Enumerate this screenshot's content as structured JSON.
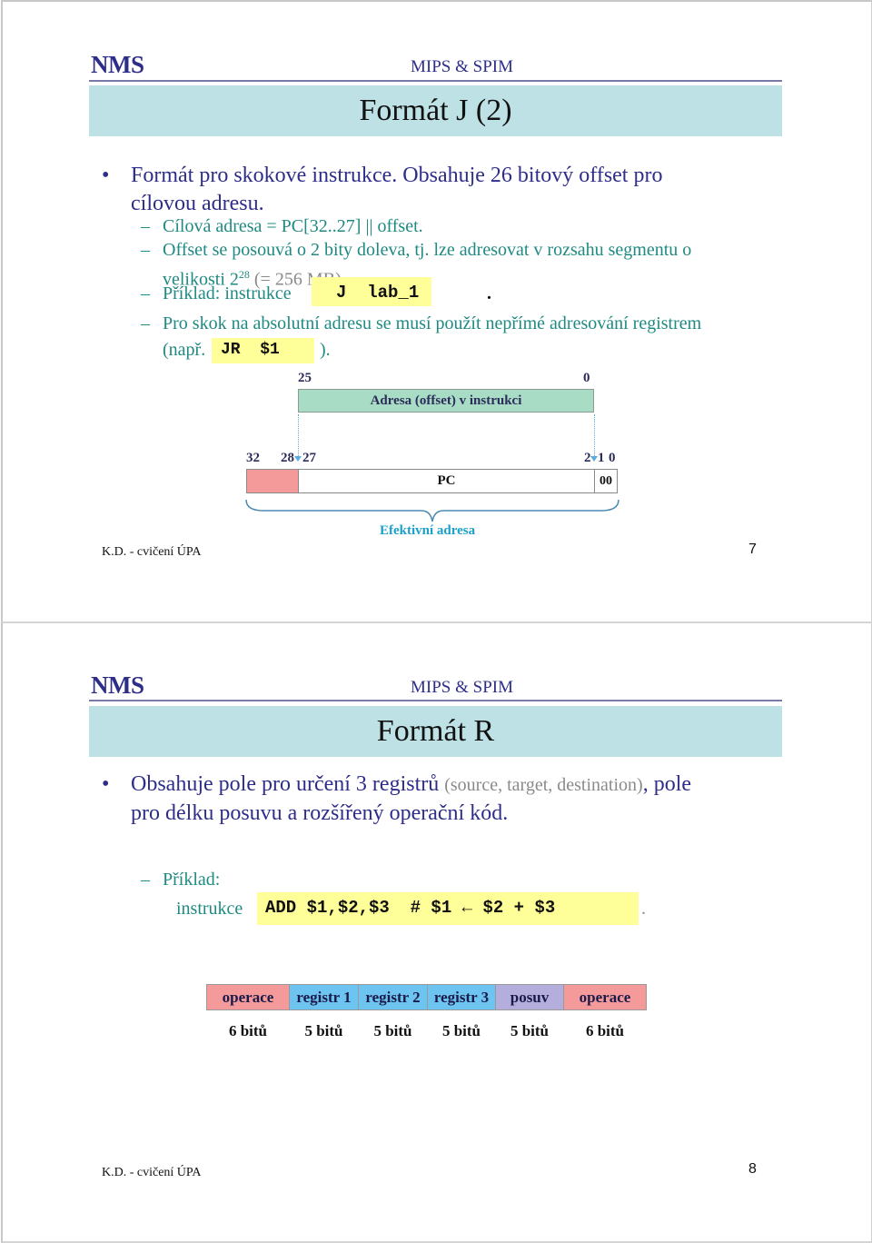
{
  "slides": [
    {
      "header": {
        "logo": "NMS",
        "course": "MIPS & SPIM"
      },
      "title": "Formát J (2)",
      "bullet": {
        "line1": "Formát pro skokové instrukce. Obsahuje 26 bitový offset pro",
        "line2": "cílovou adresu."
      },
      "sub_items": {
        "target": "Cílová adresa = PC[32..27] || offset.",
        "shift_line1": "Offset se posouvá o 2 bity doleva, tj. lze adresovat v rozsahu segmentu o",
        "shift_line2_prefix": "velikosti 2",
        "shift_sup": "28",
        "shift_line2_suffix": " (= 256 MB).",
        "example_prefix": "Příklad:  instrukce",
        "example_code": "J  lab_1",
        "example_suffix": ".",
        "abs_line1": "Pro skok na absolutní adresu se musí použít nepřímé adresování registrem",
        "abs_prefix": "(např.",
        "abs_code": "JR  $1",
        "abs_suffix": ")."
      },
      "diagram": {
        "offset_high": "25",
        "offset_low": "0",
        "offset_label": "Adresa (offset) v instrukci",
        "bit_32": "32",
        "bit_28": "28",
        "bit_27": "27",
        "bit_2": "2",
        "bit_1": "1",
        "bit_0": "0",
        "pc_label": "PC",
        "low_bits": "00",
        "effective_label": "Efektivní adresa",
        "colors": {
          "offset": "#a8dcc4",
          "pc_high": "#f59a9a",
          "effective": "#1aa0c8",
          "arrow": "#5aaede"
        }
      },
      "footer": "K.D. - cvičení ÚPA",
      "page_number": "7"
    },
    {
      "header": {
        "logo": "NMS",
        "course": "MIPS & SPIM"
      },
      "title": "Formát R",
      "bullet": {
        "part1": "Obsahuje pole pro určení 3 registrů ",
        "part_gray": "(source, target, destination)",
        "part2": ", pole",
        "line2": "pro délku posuvu a rozšířený operační kód."
      },
      "example": {
        "label": "Příklad:",
        "prefix": "instrukce",
        "code": "ADD $1,$2,$3  # $1 ← $2 + $3 ",
        "suffix": "."
      },
      "fields": [
        {
          "label": "operace",
          "bits": "6 bitů",
          "color": "#f59a9a"
        },
        {
          "label": "registr 1",
          "bits": "5 bitů",
          "color": "#6ec4f0"
        },
        {
          "label": "registr 2",
          "bits": "5 bitů",
          "color": "#6ec4f0"
        },
        {
          "label": "registr 3",
          "bits": "5 bitů",
          "color": "#6ec4f0"
        },
        {
          "label": "posuv",
          "bits": "5 bitů",
          "color": "#b4aedc"
        },
        {
          "label": "operace",
          "bits": "6 bitů",
          "color": "#f59a9a"
        }
      ],
      "footer": "K.D. - cvičení ÚPA",
      "page_number": "8"
    }
  ]
}
